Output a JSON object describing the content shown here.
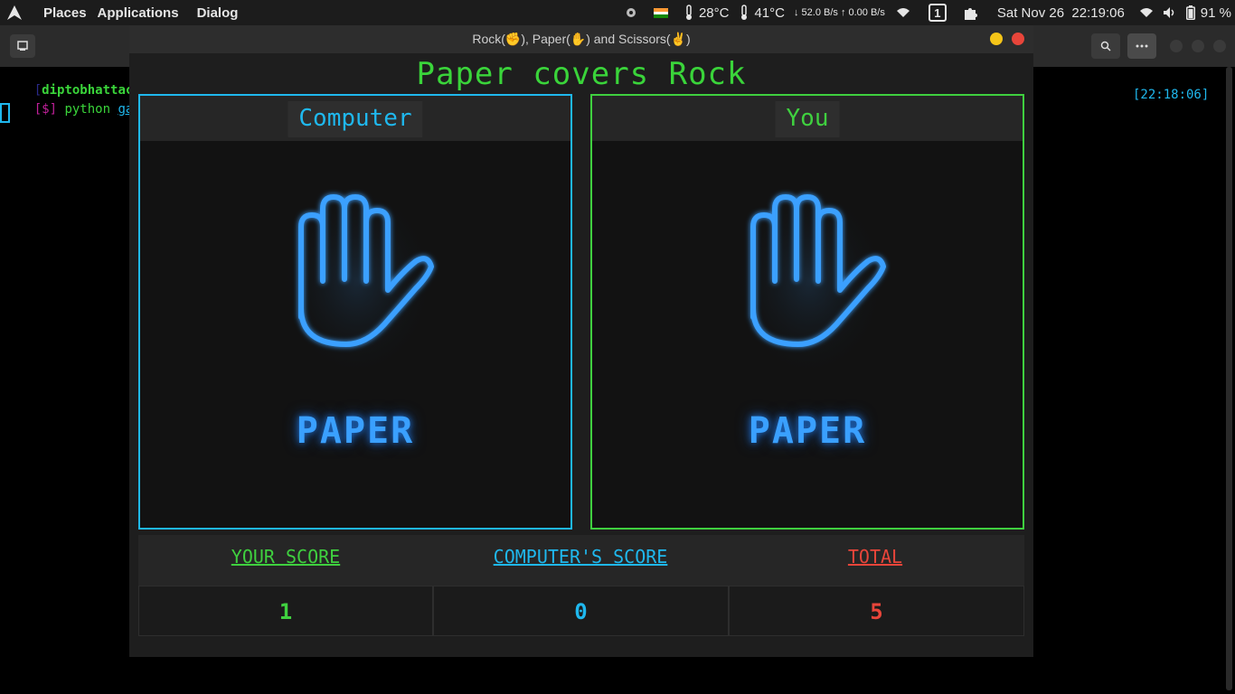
{
  "topbar": {
    "places": "Places",
    "applications": "Applications",
    "dialog": "Dialog",
    "flag_icon": "india-flag-icon",
    "cpu_temp": "28°C",
    "gpu_temp": "41°C",
    "net_speed": "↓ 52.0 B/s ↑ 0.00 B/s",
    "workspace": "1",
    "datetime": "Sat Nov 26  22:19:06",
    "battery": "91 %"
  },
  "terminal": {
    "user_prefix": "[",
    "user": "diptobhattach",
    "prompt": "[$]",
    "command": "python",
    "command_arg": "gam",
    "timestamp": "[22:18:06]"
  },
  "game_window": {
    "title": "Rock(✊), Paper(✋) and Scissors(✌)",
    "result": "Paper covers Rock",
    "computer_label": "Computer",
    "you_label": "You",
    "computer_choice": "PAPER",
    "you_choice": "PAPER",
    "scores": {
      "your_score_label": "YOUR SCORE",
      "computer_score_label": "COMPUTER'S SCORE",
      "total_label": "TOTAL",
      "your_score": "1",
      "computer_score": "0",
      "total": "5"
    }
  },
  "colors": {
    "green": "#3fd03f",
    "blue": "#1fb8ee",
    "red": "#e8453a",
    "neon_blue": "#3aa0ff"
  }
}
